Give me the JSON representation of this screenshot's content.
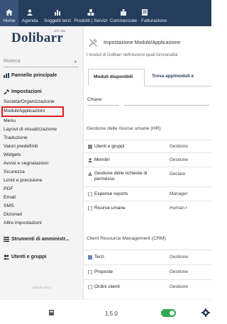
{
  "colors": {
    "topbar": "#263c5c",
    "accent": "#263c5c",
    "highlight": "#e02020",
    "toggle_on": "#2fa84f"
  },
  "topbar": {
    "items": [
      {
        "label": "Home",
        "icon": "home-icon"
      },
      {
        "label": "Agenda",
        "icon": "person-icon"
      },
      {
        "label": "Soggetti terzi",
        "icon": "chart-icon"
      },
      {
        "label": "Prodotti | Servizi",
        "icon": "cubes-icon"
      },
      {
        "label": "Commerciale",
        "icon": "briefcase-icon"
      },
      {
        "label": "Fatturazione",
        "icon": "invoice-icon"
      }
    ]
  },
  "sidebar": {
    "logo": "Dolibarr",
    "logo_tag": "ERP·CRM",
    "search_placeholder": "Ricerca",
    "dashboard": "Pannello principale",
    "setup_title": "Impostazioni",
    "setup_items": [
      "Società/Organizzazione",
      "Moduli/Applicazioni",
      "Menu",
      "Layout di visualizzazione",
      "Traduzione",
      "Valori predefiniti",
      "Widgets",
      "Avvisi e segnalazioni",
      "Sicurezza",
      "Limiti e precisione",
      "PDF",
      "Email",
      "SMS",
      "Dizionari",
      "Altre impostazioni"
    ],
    "admin_tools": "Strumenti di amministr...",
    "users_groups": "Utenti e gruppi",
    "version": "Dolibarr 8.0.2"
  },
  "main": {
    "title": "Impostazione Modulo/Applicazione",
    "description": "I moduli di Dolibarr definiscono quali funzionalità",
    "tabs": [
      {
        "label": "Moduli disponibili"
      },
      {
        "label": "Trova app/moduli e"
      }
    ],
    "key_label": "Chiave:",
    "sections": [
      {
        "title": "Gestione delle risorse umane (HR)",
        "rows": [
          {
            "name": "Utenti e gruppi",
            "value": "Gestione"
          },
          {
            "name": "Membri",
            "value": "Gestione"
          },
          {
            "name": "Gestione delle richieste di permesso",
            "value": "Declare"
          },
          {
            "name": "Expense reports",
            "value": "Manager"
          },
          {
            "name": "Risorse umane",
            "value": "Human r"
          }
        ]
      },
      {
        "title": "Client Resource Management (CRM)",
        "rows": [
          {
            "name": "Terzi",
            "value": "Gestione"
          },
          {
            "name": "Proposte",
            "value": "Gestione"
          },
          {
            "name": "Ordini clienti",
            "value": "Gestione"
          }
        ]
      }
    ]
  },
  "bottombar": {
    "version": "1.5.0"
  }
}
